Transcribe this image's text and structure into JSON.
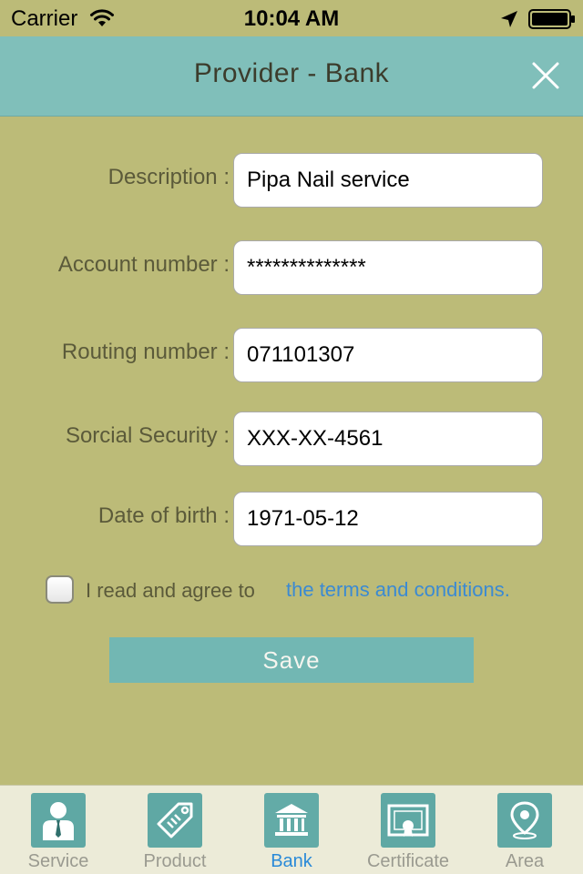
{
  "status_bar": {
    "carrier": "Carrier",
    "time": "10:04 AM"
  },
  "header": {
    "title": "Provider - Bank"
  },
  "form": {
    "fields": [
      {
        "label": "Description :",
        "value": "Pipa Nail service"
      },
      {
        "label": "Account number :",
        "value": "**************"
      },
      {
        "label": "Routing number :",
        "value": "071101307"
      },
      {
        "label": "Sorcial Security :",
        "value": "XXX-XX-4561"
      },
      {
        "label": "Date of birth :",
        "value": "1971-05-12"
      }
    ],
    "agree_text": "I read and agree to",
    "terms_link": "the terms and conditions.",
    "agree_checked": false,
    "save_label": "Save"
  },
  "tab_bar": {
    "active": "Bank",
    "tabs": [
      {
        "label": "Service",
        "icon": "person-icon"
      },
      {
        "label": "Product",
        "icon": "tag-icon"
      },
      {
        "label": "Bank",
        "icon": "bank-icon"
      },
      {
        "label": "Certificate",
        "icon": "certificate-icon"
      },
      {
        "label": "Area",
        "icon": "map-pin-icon"
      }
    ]
  },
  "colors": {
    "background": "#bcbb78",
    "header": "#80bfba",
    "accent": "#72b7b3",
    "link": "#3b8ad2",
    "active_tab": "#2a8ad8"
  }
}
